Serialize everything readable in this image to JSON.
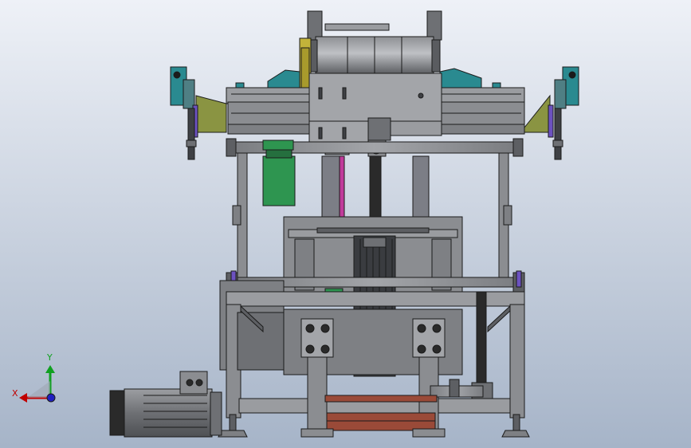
{
  "triad": {
    "x_label": "X",
    "y_label": "Y",
    "x_color": "#c00000",
    "y_color": "#10a020",
    "z_color": "#2020c0"
  },
  "colors": {
    "background_top": "#eef1f7",
    "background_bottom": "#a6b4c8",
    "frame": "#8b8d91",
    "frame_dark": "#5d5f63",
    "outline": "#1b1b1b",
    "teal": "#2a8a90",
    "green": "#2e9550",
    "olive": "#8a9442",
    "yellow": "#c2b33a",
    "magenta": "#c03a9a",
    "purple": "#6c52c0",
    "brown": "#9a4a38",
    "black_rail": "#2a2a2a"
  }
}
